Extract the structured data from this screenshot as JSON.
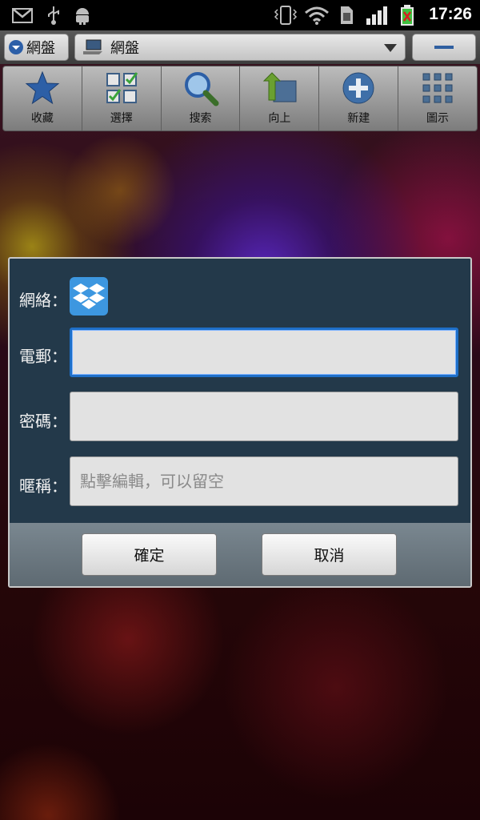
{
  "status_bar": {
    "time": "17:26",
    "icons": [
      "gmail-icon",
      "usb-icon",
      "android-debug-icon",
      "vibrate-icon",
      "wifi-icon",
      "sim-icon",
      "signal-icon",
      "battery-icon"
    ]
  },
  "location_bar": {
    "account_label": "網盤",
    "path_label": "網盤"
  },
  "toolbar": {
    "items": [
      {
        "label": "收藏",
        "icon": "star-icon"
      },
      {
        "label": "選擇",
        "icon": "select-grid-icon"
      },
      {
        "label": "搜索",
        "icon": "search-icon"
      },
      {
        "label": "向上",
        "icon": "folder-up-icon"
      },
      {
        "label": "新建",
        "icon": "add-icon"
      },
      {
        "label": "圖示",
        "icon": "icon-view-icon"
      }
    ]
  },
  "dialog": {
    "network_label": "網絡：",
    "network_icon": "dropbox-icon",
    "email_label": "電郵：",
    "email_value": "",
    "password_label": "密碼：",
    "password_value": "",
    "nickname_label": "暱稱：",
    "nickname_placeholder": "點擊編輯，可以留空",
    "ok_label": "確定",
    "cancel_label": "取消"
  },
  "colors": {
    "dialog_bg": "#23394a",
    "focus_border": "#1e6fc8"
  }
}
